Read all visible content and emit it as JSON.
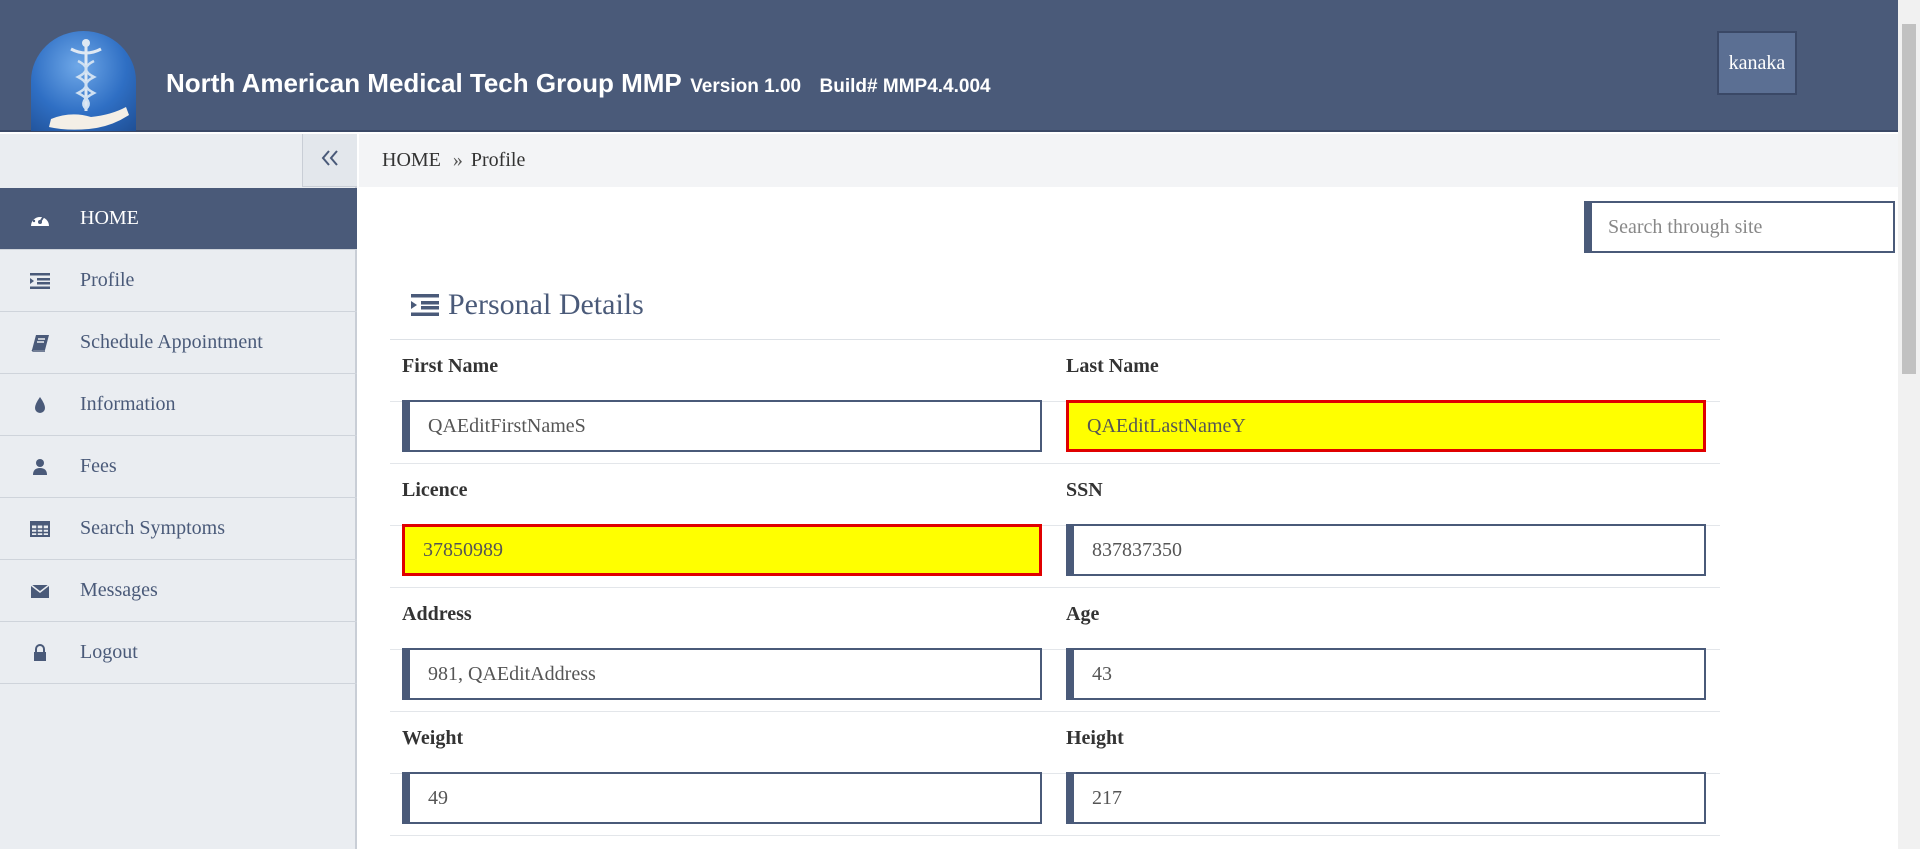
{
  "header": {
    "app_name": "North American Medical Tech Group MMP",
    "version": "Version 1.00",
    "build": "Build# MMP4.4.004",
    "user_button": "kanaka"
  },
  "sidebar": {
    "collapse_icon": "double-chevron-left-icon",
    "items": [
      {
        "label": "HOME",
        "icon": "dashboard-icon",
        "active": true
      },
      {
        "label": "Profile",
        "icon": "list-indent-icon"
      },
      {
        "label": "Schedule Appointment",
        "icon": "book-icon"
      },
      {
        "label": "Information",
        "icon": "droplet-icon"
      },
      {
        "label": "Fees",
        "icon": "user-icon"
      },
      {
        "label": "Search Symptoms",
        "icon": "table-icon"
      },
      {
        "label": "Messages",
        "icon": "envelope-icon"
      },
      {
        "label": "Logout",
        "icon": "lock-icon"
      }
    ]
  },
  "breadcrumb": {
    "home": "HOME",
    "separator": "»",
    "current": "Profile"
  },
  "search": {
    "placeholder": "Search through site"
  },
  "section": {
    "title": "Personal Details",
    "icon": "list-indent-icon"
  },
  "form": {
    "first_name": {
      "label": "First Name",
      "value": "QAEditFirstNameS"
    },
    "last_name": {
      "label": "Last Name",
      "value": "QAEditLastNameY",
      "highlighted": true
    },
    "licence": {
      "label": "Licence",
      "value": "37850989",
      "highlighted": true
    },
    "ssn": {
      "label": "SSN",
      "value": "837837350"
    },
    "address": {
      "label": "Address",
      "value": "981, QAEditAddress"
    },
    "age": {
      "label": "Age",
      "value": "43"
    },
    "weight": {
      "label": "Weight",
      "value": "49"
    },
    "height": {
      "label": "Height",
      "value": "217"
    }
  },
  "colors": {
    "primary": "#4a5a79",
    "highlight_bg": "#ffff00",
    "highlight_border": "#e00000"
  }
}
